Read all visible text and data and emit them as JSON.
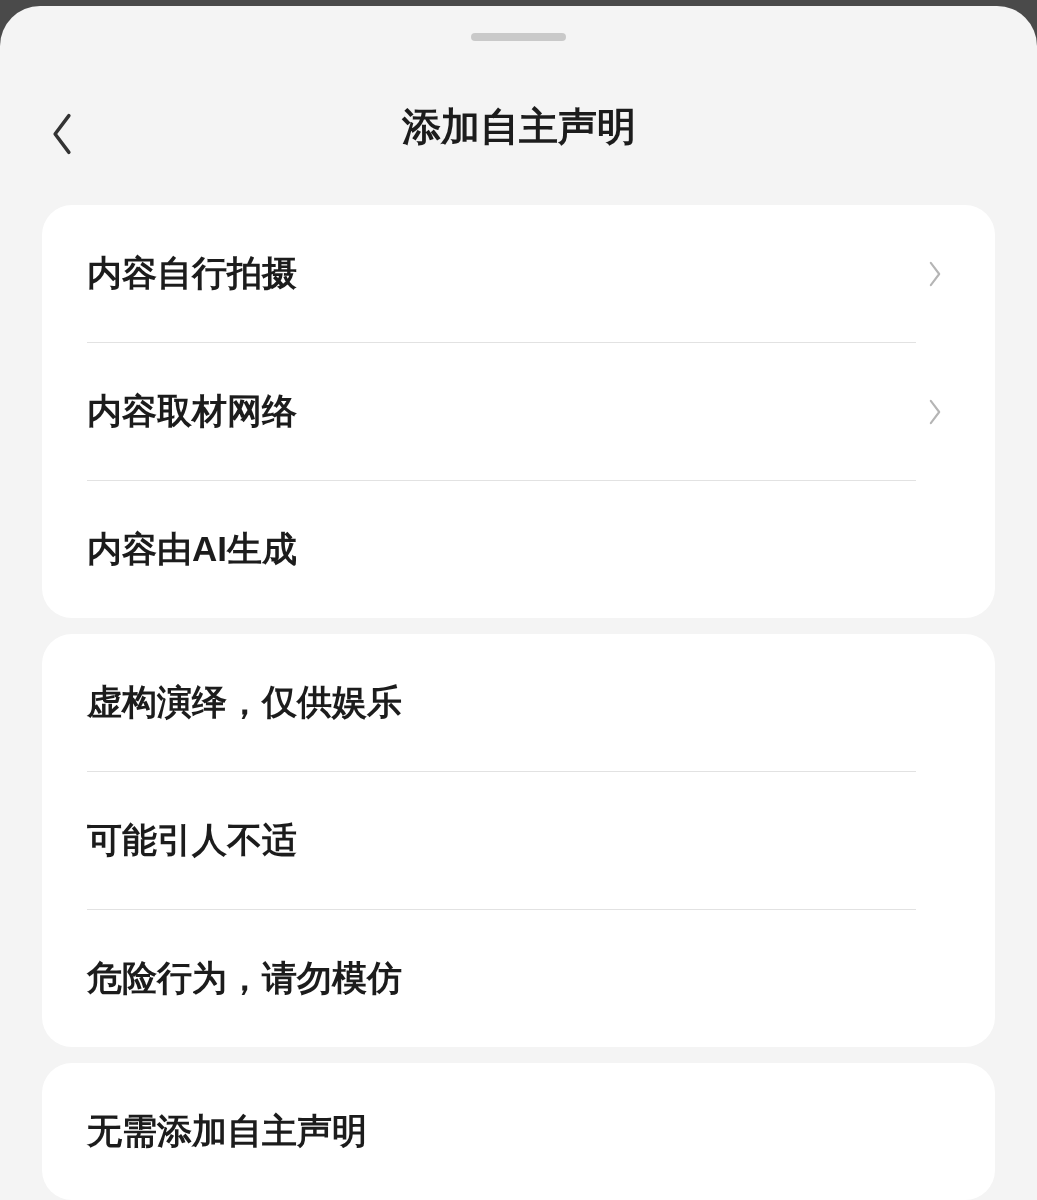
{
  "header": {
    "title": "添加自主声明"
  },
  "groups": [
    {
      "items": [
        {
          "label": "内容自行拍摄",
          "chevron": true
        },
        {
          "label": "内容取材网络",
          "chevron": true
        },
        {
          "label": "内容由AI生成",
          "chevron": false
        }
      ]
    },
    {
      "items": [
        {
          "label": "虚构演绎，仅供娱乐",
          "chevron": false
        },
        {
          "label": "可能引人不适",
          "chevron": false
        },
        {
          "label": "危险行为，请勿模仿",
          "chevron": false
        }
      ]
    },
    {
      "items": [
        {
          "label": "无需添加自主声明",
          "chevron": false
        }
      ]
    }
  ]
}
